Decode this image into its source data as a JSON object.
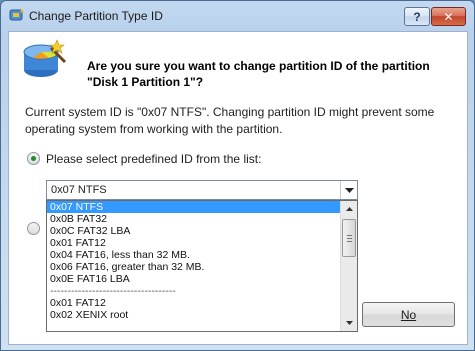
{
  "window": {
    "title": "Change Partition Type ID",
    "help_label": "?",
    "close_label": "✕"
  },
  "dialog": {
    "question_line1": "Are you sure you want to change partition ID of the partition",
    "question_line2": "\"Disk 1 Partition 1\"?",
    "info_text": "Current system ID is \"0x07 NTFS\". Changing partition ID might prevent some operating system from working with the partition.",
    "radio_predefined_label": "Please select predefined ID from the list:",
    "combo_value": "0x07 NTFS",
    "list_items": [
      "0x07 NTFS",
      "0x0B FAT32",
      "0x0C FAT32 LBA",
      "0x01 FAT12",
      "0x04 FAT16, less than 32 MB.",
      "0x06 FAT16, greater than 32 MB.",
      "0x0E FAT16 LBA",
      "------------------------------------",
      "0x01 FAT12",
      "0x02 XENIX root"
    ],
    "no_button_label": "No"
  },
  "colors": {
    "selection": "#3399ff",
    "close_button": "#c4452a",
    "radio_checked": "#2a8a2a"
  }
}
